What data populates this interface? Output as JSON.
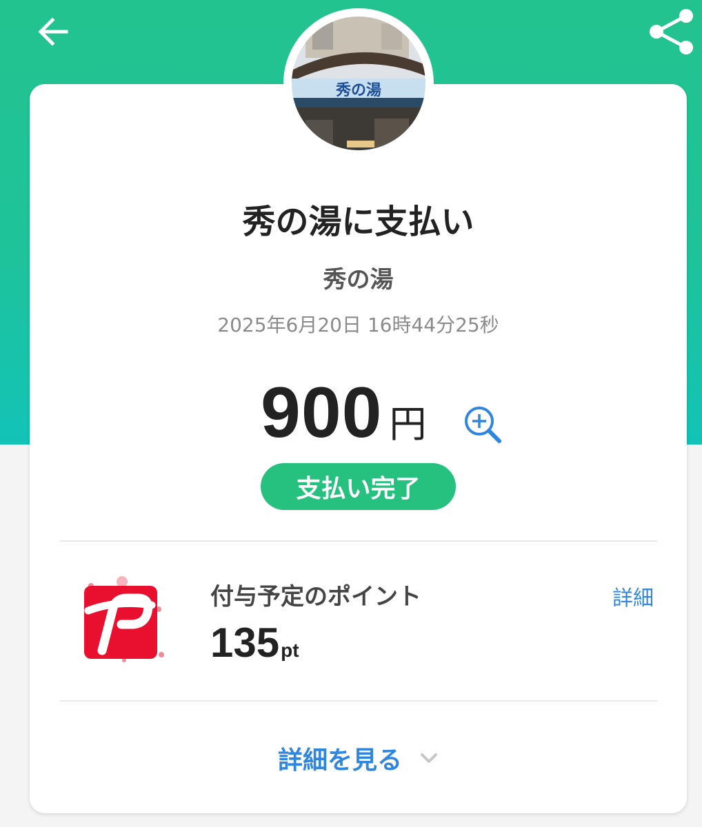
{
  "header": {
    "back_icon": "arrow-left-icon",
    "share_icon": "share-icon",
    "bg_colors": [
      "#22c38e",
      "#12c3b6"
    ]
  },
  "store": {
    "photo_sign_text": "秀の湯"
  },
  "transaction": {
    "title": "秀の湯に支払い",
    "merchant": "秀の湯",
    "datetime": "2025年6月20日 16時44分25秒",
    "amount": "900",
    "currency": "円",
    "zoom_icon": "zoom-in-icon",
    "status": "支払い完了",
    "status_color": "#26c07f"
  },
  "points": {
    "label": "付与予定のポイント",
    "value": "135",
    "unit": "pt",
    "details_link": "詳細",
    "logo_icon": "paypay-logo-icon",
    "link_color": "#2f86e0"
  },
  "footer": {
    "more_label": "詳細を見る",
    "chevron_icon": "chevron-down-icon"
  }
}
